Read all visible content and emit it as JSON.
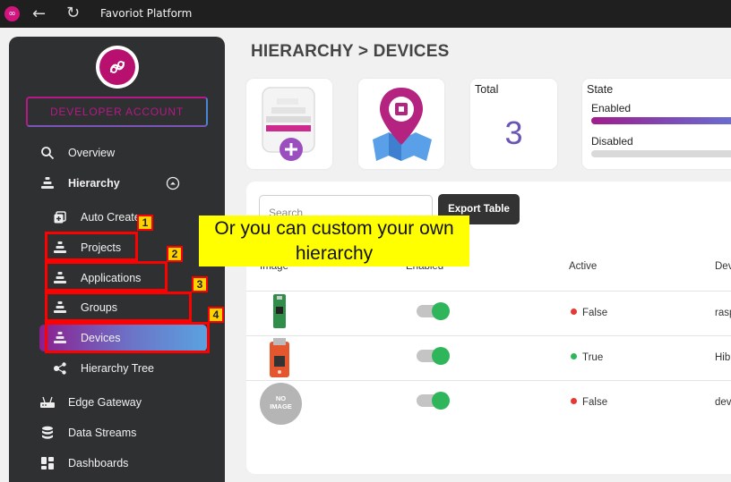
{
  "titlebar": {
    "title": "Favoriot Platform"
  },
  "sidebar": {
    "account_label": "DEVELOPER ACCOUNT",
    "items": [
      {
        "label": "Overview"
      },
      {
        "label": "Hierarchy"
      },
      {
        "label": "Auto Create"
      },
      {
        "label": "Projects"
      },
      {
        "label": "Applications"
      },
      {
        "label": "Groups"
      },
      {
        "label": "Devices"
      },
      {
        "label": "Hierarchy Tree"
      },
      {
        "label": "Edge Gateway"
      },
      {
        "label": "Data Streams"
      },
      {
        "label": "Dashboards"
      }
    ]
  },
  "main": {
    "heading": "HIERARCHY > DEVICES",
    "total": {
      "label": "Total",
      "value": "3"
    },
    "state": {
      "label": "State",
      "enabled_label": "Enabled",
      "disabled_label": "Disabled"
    },
    "search": {
      "placeholder": "Search"
    },
    "export_label": "Export Table",
    "columns": [
      "Image",
      "Enabled",
      "Active",
      "Dev"
    ],
    "rows": [
      {
        "active": "False",
        "device": "rasp",
        "status_color": "#e53935"
      },
      {
        "active": "True",
        "device": "Hib",
        "status_color": "#2fb65a"
      },
      {
        "active": "False",
        "device": "dev",
        "status_color": "#e53935",
        "image_placeholder": "NO IMAGE"
      }
    ]
  },
  "annotations": {
    "callout": "Or you can custom your own hierarchy",
    "markers": [
      "1",
      "2",
      "3",
      "4"
    ]
  },
  "colors": {
    "brand": "#b8106f",
    "active_green": "#2fb65a",
    "inactive_red": "#e53935",
    "highlight": "#ff0000",
    "callout_bg": "#ffff00"
  }
}
